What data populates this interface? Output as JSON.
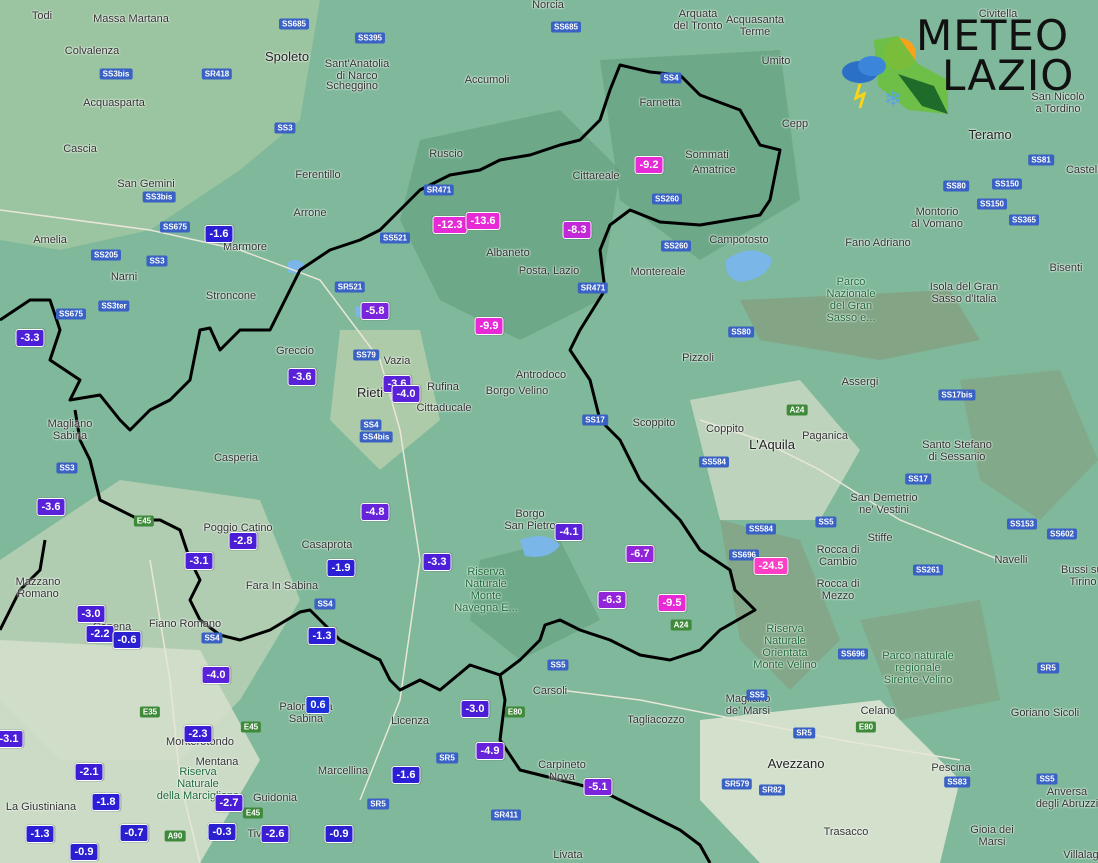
{
  "map": {
    "places": [
      {
        "name": "Todi",
        "big": false
      },
      {
        "name": "Massa Martana",
        "big": false
      },
      {
        "name": "Spoleto",
        "big": true
      },
      {
        "name": "Sant'Anatolia\ndi Narco",
        "big": false
      },
      {
        "name": "Scheggino",
        "big": false
      },
      {
        "name": "Norcia",
        "big": false
      },
      {
        "name": "Arquata\ndel Tronto",
        "big": false
      },
      {
        "name": "Acquasanta\nTerme",
        "big": false
      },
      {
        "name": "Umito",
        "big": false
      },
      {
        "name": "Colvalenza",
        "big": false
      },
      {
        "name": "Acquasparta",
        "big": false
      },
      {
        "name": "Cascia",
        "big": false
      },
      {
        "name": "Accumoli",
        "big": false
      },
      {
        "name": "Farnetta",
        "big": false
      },
      {
        "name": "Ruscio",
        "big": false
      },
      {
        "name": "Sommati",
        "big": false
      },
      {
        "name": "Amatrice",
        "big": false
      },
      {
        "name": "Cittareale",
        "big": false
      },
      {
        "name": "Ferentillo",
        "big": false
      },
      {
        "name": "San Gemini",
        "big": false
      },
      {
        "name": "Arrone",
        "big": false
      },
      {
        "name": "Leonessa",
        "big": false
      },
      {
        "name": "Amelia",
        "big": false
      },
      {
        "name": "Marmore",
        "big": false
      },
      {
        "name": "Albaneto",
        "big": false
      },
      {
        "name": "Posta, Lazio",
        "big": false
      },
      {
        "name": "Campotosto",
        "big": false
      },
      {
        "name": "Narni",
        "big": false
      },
      {
        "name": "Montereale",
        "big": false
      },
      {
        "name": "Stroncone",
        "big": false
      },
      {
        "name": "Greccio",
        "big": false
      },
      {
        "name": "Vazia",
        "big": false
      },
      {
        "name": "Pizzoli",
        "big": false
      },
      {
        "name": "Rieti",
        "big": true
      },
      {
        "name": "Rufina",
        "big": false
      },
      {
        "name": "Cittaducale",
        "big": false
      },
      {
        "name": "Antrodoco",
        "big": false
      },
      {
        "name": "Borgo Velino",
        "big": false
      },
      {
        "name": "Assergi",
        "big": false
      },
      {
        "name": "Magliano\nSabina",
        "big": false
      },
      {
        "name": "Scoppito",
        "big": false
      },
      {
        "name": "Coppito",
        "big": false
      },
      {
        "name": "L'Aquila",
        "big": true
      },
      {
        "name": "Paganica",
        "big": false
      },
      {
        "name": "Casperia",
        "big": false
      },
      {
        "name": "Santo Stefano\ndi Sessanio",
        "big": false
      },
      {
        "name": "Borgo\nSan Pietro",
        "big": false
      },
      {
        "name": "Poggio Catino",
        "big": false
      },
      {
        "name": "Casaprota",
        "big": false
      },
      {
        "name": "San Demetrio\nne' Vestini",
        "big": false
      },
      {
        "name": "Stiffe",
        "big": false
      },
      {
        "name": "Rocca di\nCambio",
        "big": false
      },
      {
        "name": "Navelli",
        "big": false
      },
      {
        "name": "Fara In Sabina",
        "big": false
      },
      {
        "name": "Rocca di\nMezzo",
        "big": false
      },
      {
        "name": "Mazzano\nRomano",
        "big": false
      },
      {
        "name": "Fiano Romano",
        "big": false
      },
      {
        "name": "Capena",
        "big": false
      },
      {
        "name": "Carsoli",
        "big": false
      },
      {
        "name": "Tagliacozzo",
        "big": false
      },
      {
        "name": "Magliano\nde' Marsi",
        "big": false
      },
      {
        "name": "Celano",
        "big": false
      },
      {
        "name": "Goriano Sicoli",
        "big": false
      },
      {
        "name": "Palombara\nSabina",
        "big": false
      },
      {
        "name": "Licenza",
        "big": false
      },
      {
        "name": "Monterotondo",
        "big": false
      },
      {
        "name": "Mentana",
        "big": false
      },
      {
        "name": "Marcellina",
        "big": false
      },
      {
        "name": "Avezzano",
        "big": true
      },
      {
        "name": "Pescina",
        "big": false
      },
      {
        "name": "La Giustiniana",
        "big": false
      },
      {
        "name": "Guidonia",
        "big": false
      },
      {
        "name": "Tivoli",
        "big": false
      },
      {
        "name": "Trasacco",
        "big": false
      },
      {
        "name": "Gioia dei\nMarsi",
        "big": false
      },
      {
        "name": "Livata",
        "big": false
      },
      {
        "name": "Teramo",
        "big": true
      },
      {
        "name": "Montorio\nal Vomano",
        "big": false
      },
      {
        "name": "Fano Adriano",
        "big": false
      },
      {
        "name": "Isola del Gran\nSasso d'Italia",
        "big": false
      },
      {
        "name": "Bisenti",
        "big": false
      },
      {
        "name": "Cepp",
        "big": false
      },
      {
        "name": "San Nicolò\na Tordino",
        "big": false
      },
      {
        "name": "Civitella",
        "big": false
      },
      {
        "name": "Castelli",
        "big": false
      },
      {
        "name": "Bussi sul\nTirino",
        "big": false
      },
      {
        "name": "Anversa\ndegli Abruzzi",
        "big": false
      },
      {
        "name": "Villalago",
        "big": false
      },
      {
        "name": "Carpineto\nNova",
        "big": false
      }
    ],
    "parks": [
      {
        "name": "Parco\nNazionale\ndel Gran\nSasso e..."
      },
      {
        "name": "Riserva\nNaturale\nMonte\nNavegna E..."
      },
      {
        "name": "Riserva\nNaturale\nOrientata\nMonte Velino"
      },
      {
        "name": "Parco naturale\nregionale\nSirente-Velino"
      },
      {
        "name": "Riserva\nNaturale\ndella Marcigliana"
      }
    ],
    "roads": [
      {
        "label": "SS685"
      },
      {
        "label": "SS395"
      },
      {
        "label": "SS685"
      },
      {
        "label": "SR418"
      },
      {
        "label": "SS3bis"
      },
      {
        "label": "SS3"
      },
      {
        "label": "SS3bis"
      },
      {
        "label": "SS4"
      },
      {
        "label": "SR471"
      },
      {
        "label": "SS675"
      },
      {
        "label": "SS521"
      },
      {
        "label": "SS260"
      },
      {
        "label": "SS260"
      },
      {
        "label": "SS205"
      },
      {
        "label": "SS3"
      },
      {
        "label": "SR521"
      },
      {
        "label": "SR471"
      },
      {
        "label": "SS675"
      },
      {
        "label": "SS3ter"
      },
      {
        "label": "SS79"
      },
      {
        "label": "SS4"
      },
      {
        "label": "SS4bis"
      },
      {
        "label": "SS17"
      },
      {
        "label": "SS80"
      },
      {
        "label": "A24"
      },
      {
        "label": "SS584"
      },
      {
        "label": "SS17"
      },
      {
        "label": "SS17bis"
      },
      {
        "label": "SS3"
      },
      {
        "label": "E45"
      },
      {
        "label": "SS584"
      },
      {
        "label": "SS5"
      },
      {
        "label": "SS696"
      },
      {
        "label": "SS4"
      },
      {
        "label": "SS4"
      },
      {
        "label": "A24"
      },
      {
        "label": "SS5"
      },
      {
        "label": "SS261"
      },
      {
        "label": "SS153"
      },
      {
        "label": "SS602"
      },
      {
        "label": "E80"
      },
      {
        "label": "SS696"
      },
      {
        "label": "E45"
      },
      {
        "label": "SR5"
      },
      {
        "label": "SS5"
      },
      {
        "label": "E80"
      },
      {
        "label": "E35"
      },
      {
        "label": "SR5"
      },
      {
        "label": "SR579"
      },
      {
        "label": "SR82"
      },
      {
        "label": "SR5"
      },
      {
        "label": "A90"
      },
      {
        "label": "E45"
      },
      {
        "label": "SR411"
      },
      {
        "label": "SS83"
      },
      {
        "label": "SS80"
      },
      {
        "label": "SS150"
      },
      {
        "label": "SS150"
      },
      {
        "label": "SS365"
      },
      {
        "label": "SS81"
      },
      {
        "label": "SR5"
      },
      {
        "label": "SS5"
      }
    ],
    "temps": [
      {
        "value": "-1.6",
        "color": "#2b1fd6"
      },
      {
        "value": "-12.3",
        "color": "#e62bd6"
      },
      {
        "value": "-13.6",
        "color": "#e62bd6"
      },
      {
        "value": "-9.2",
        "color": "#e62bd6"
      },
      {
        "value": "-8.3",
        "color": "#c227d8"
      },
      {
        "value": "-5.8",
        "color": "#7a24dc"
      },
      {
        "value": "-9.9",
        "color": "#e62bd6"
      },
      {
        "value": "-3.3",
        "color": "#4c1fd8"
      },
      {
        "value": "-3.6",
        "color": "#5a22d8"
      },
      {
        "value": "-3.6",
        "color": "#5a22d8"
      },
      {
        "value": "-4.0",
        "color": "#5a22d8"
      },
      {
        "value": "-3.6",
        "color": "#5a22d8"
      },
      {
        "value": "-4.8",
        "color": "#6623da"
      },
      {
        "value": "-2.8",
        "color": "#4a1ed6"
      },
      {
        "value": "-3.1",
        "color": "#4c1fd8"
      },
      {
        "value": "-1.9",
        "color": "#2b1fd6"
      },
      {
        "value": "-3.3",
        "color": "#4c1fd8"
      },
      {
        "value": "-4.1",
        "color": "#5a22d8"
      },
      {
        "value": "-6.7",
        "color": "#9225da"
      },
      {
        "value": "-24.5",
        "color": "#ff3ec8"
      },
      {
        "value": "-6.3",
        "color": "#9225da"
      },
      {
        "value": "-9.5",
        "color": "#e62bd6"
      },
      {
        "value": "-3.0",
        "color": "#4a1ed6"
      },
      {
        "value": "-2.2",
        "color": "#3a1ed6"
      },
      {
        "value": "-0.6",
        "color": "#2a20d0"
      },
      {
        "value": "-1.3",
        "color": "#2b1fd6"
      },
      {
        "value": "-4.0",
        "color": "#5a22d8"
      },
      {
        "value": "0.6",
        "color": "#1c2fd8"
      },
      {
        "value": "-3.0",
        "color": "#4a1ed6"
      },
      {
        "value": "-4.9",
        "color": "#6623da"
      },
      {
        "value": "-2.3",
        "color": "#3a1ed6"
      },
      {
        "value": "-2.1",
        "color": "#3a1ed6"
      },
      {
        "value": "-1.6",
        "color": "#2b1fd6"
      },
      {
        "value": "-1.8",
        "color": "#2b1fd6"
      },
      {
        "value": "-2.7",
        "color": "#4a1ed6"
      },
      {
        "value": "-5.1",
        "color": "#7a24dc"
      },
      {
        "value": "-1.3",
        "color": "#2b1fd6"
      },
      {
        "value": "-0.7",
        "color": "#2a20d0"
      },
      {
        "value": "-0.3",
        "color": "#2a20d0"
      },
      {
        "value": "-2.6",
        "color": "#3a1ed6"
      },
      {
        "value": "-0.9",
        "color": "#2a20d0"
      },
      {
        "value": "-0.9",
        "color": "#2a20d0"
      },
      {
        "value": "-3.1",
        "color": "#4c1fd8"
      }
    ]
  },
  "logo": {
    "line1": "METEO",
    "line2": "LAZIO"
  },
  "colors": {
    "border": "#000000",
    "terrain": "#7fb89a",
    "terrain_dark": "#5e9c7a",
    "plain": "#d8e2cf",
    "lake": "#7ab6e8"
  }
}
